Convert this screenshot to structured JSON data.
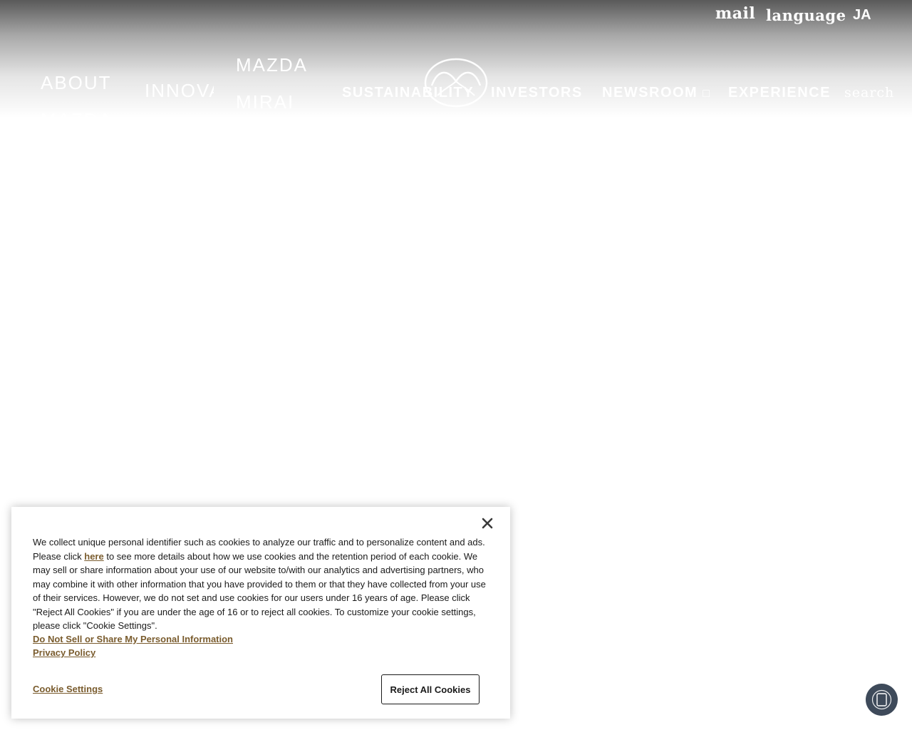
{
  "header": {
    "utility": {
      "mail_label": "mail",
      "language_label": "language",
      "ja_label": "JA"
    },
    "nav": {
      "about_line1": "ABOUT",
      "about_line2": "MAZDA",
      "innovation": "INNOVATION",
      "mirai_line1": "MAZDA",
      "mirai_line2": "MIRAI",
      "sustainability": "SUSTAINABILITY",
      "investors": "INVESTORS",
      "newsroom": "NEWSROOM",
      "newsroom_icon_glyph": "□",
      "experience": "EXPERIENCE",
      "search_label": "search"
    },
    "logo_icon": "mazda-logo"
  },
  "cookie_banner": {
    "text_part1": "We collect unique personal identifier such as cookies to analyze our traffic and to personalize content and ads. Please click ",
    "here_link": "here",
    "text_part2": " to see more details about how we use cookies and the retention period of each cookie. We may sell or share information about your use of our website to/with our analytics and advertising partners, who may combine it with other information that you have provided to them or that they have collected from your use of their services. However, we do not set and use cookies for our users under 16 years of age. Please click \"Reject All Cookies\" if you are under the age of 16 or to reject all cookies. To customize your cookie settings, please click \"Cookie Settings\".",
    "do_not_sell_link": "Do Not Sell or Share My Personal Information",
    "privacy_policy_link": "Privacy Policy",
    "cookie_settings_label": "Cookie Settings",
    "reject_all_label": "Reject All Cookies",
    "close_icon": "close-icon",
    "link_color": "#7a5c2e"
  },
  "chat_widget": {
    "icon": "chat-icon",
    "color": "#3e4a5a"
  }
}
